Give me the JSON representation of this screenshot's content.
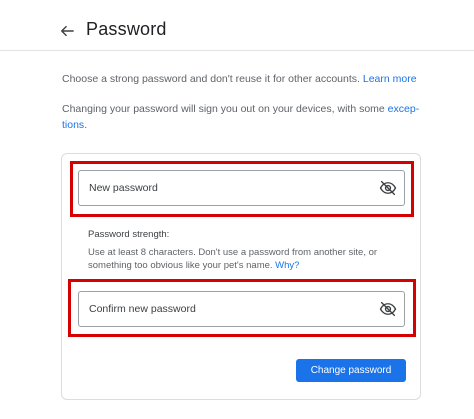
{
  "header": {
    "back_icon": "arrow-left-icon",
    "title": "Password"
  },
  "intro": {
    "line1_text": "Choose a strong password and don't reuse it for other accounts.",
    "learn_more": "Learn more",
    "line2_text": "Changing your password will sign you out on your devices, with some",
    "line2_link_part1": "excep-",
    "line3_link_part2": "tions",
    "line3_period": "."
  },
  "form": {
    "new_password": {
      "placeholder": "New password",
      "value": "",
      "icon": "eye-off-icon"
    },
    "strength": {
      "label": "Password strength:",
      "hint_line1": "Use at least 8 characters. Don't use a password from another site, or",
      "hint_line2": "something too obvious like your pet's name.",
      "why_link": "Why?"
    },
    "confirm_password": {
      "placeholder": "Confirm new password",
      "value": "",
      "icon": "eye-off-icon"
    },
    "submit_label": "Change password"
  },
  "colors": {
    "accent": "#1a73e8",
    "highlight_border": "#d50000",
    "text": "#3c4043",
    "secondary_text": "#5f6368"
  }
}
